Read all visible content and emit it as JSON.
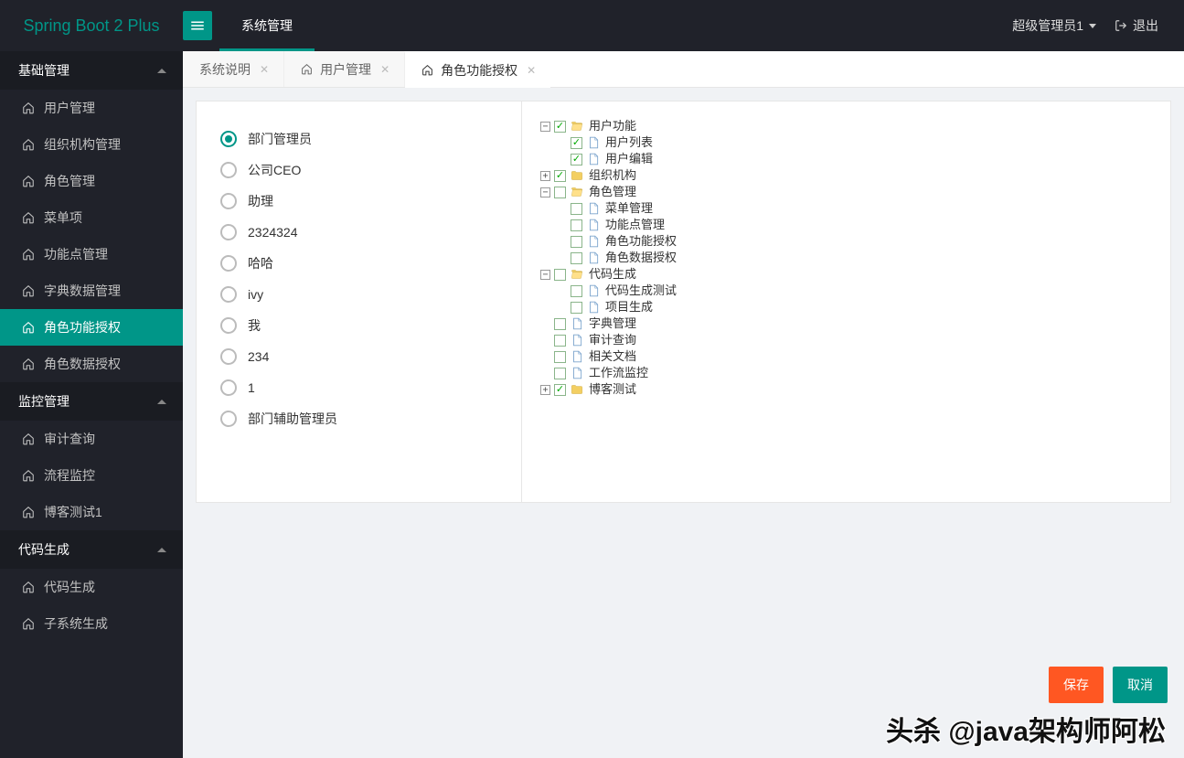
{
  "header": {
    "logo": "Spring Boot 2 Plus",
    "top_tabs": [
      {
        "label": "系统管理",
        "active": true
      }
    ],
    "user": "超级管理员1",
    "logout": "退出"
  },
  "sidebar": [
    {
      "title": "基础管理",
      "items": [
        {
          "label": "用户管理",
          "active": false
        },
        {
          "label": "组织机构管理",
          "active": false
        },
        {
          "label": "角色管理",
          "active": false
        },
        {
          "label": "菜单项",
          "active": false
        },
        {
          "label": "功能点管理",
          "active": false
        },
        {
          "label": "字典数据管理",
          "active": false
        },
        {
          "label": "角色功能授权",
          "active": true
        },
        {
          "label": "角色数据授权",
          "active": false
        }
      ]
    },
    {
      "title": "监控管理",
      "items": [
        {
          "label": "审计查询",
          "active": false
        },
        {
          "label": "流程监控",
          "active": false
        },
        {
          "label": "博客测试1",
          "active": false
        }
      ]
    },
    {
      "title": "代码生成",
      "items": [
        {
          "label": "代码生成",
          "active": false
        },
        {
          "label": "子系统生成",
          "active": false
        }
      ]
    }
  ],
  "tabs": [
    {
      "label": "系统说明",
      "icon": false,
      "active": false
    },
    {
      "label": "用户管理",
      "icon": true,
      "active": false
    },
    {
      "label": "角色功能授权",
      "icon": true,
      "active": true
    }
  ],
  "roles": [
    {
      "label": "部门管理员",
      "checked": true
    },
    {
      "label": "公司CEO",
      "checked": false
    },
    {
      "label": "助理",
      "checked": false
    },
    {
      "label": "2324324",
      "checked": false
    },
    {
      "label": "哈哈",
      "checked": false
    },
    {
      "label": "ivy",
      "checked": false
    },
    {
      "label": "我",
      "checked": false
    },
    {
      "label": "234",
      "checked": false
    },
    {
      "label": "1",
      "checked": false
    },
    {
      "label": "部门辅助管理员",
      "checked": false
    }
  ],
  "tree": [
    {
      "label": "用户功能",
      "type": "folder",
      "checked": true,
      "expanded": true,
      "children": [
        {
          "label": "用户列表",
          "type": "file",
          "checked": true
        },
        {
          "label": "用户编辑",
          "type": "file",
          "checked": true
        }
      ]
    },
    {
      "label": "组织机构",
      "type": "folder",
      "checked": true,
      "expanded": false,
      "has_children": true
    },
    {
      "label": "角色管理",
      "type": "folder",
      "checked": false,
      "expanded": true,
      "children": [
        {
          "label": "菜单管理",
          "type": "file",
          "checked": false
        },
        {
          "label": "功能点管理",
          "type": "file",
          "checked": false
        },
        {
          "label": "角色功能授权",
          "type": "file",
          "checked": false
        },
        {
          "label": "角色数据授权",
          "type": "file",
          "checked": false
        }
      ]
    },
    {
      "label": "代码生成",
      "type": "folder",
      "checked": false,
      "expanded": true,
      "children": [
        {
          "label": "代码生成测试",
          "type": "file",
          "checked": false
        },
        {
          "label": "项目生成",
          "type": "file",
          "checked": false
        }
      ]
    },
    {
      "label": "字典管理",
      "type": "file",
      "checked": false
    },
    {
      "label": "审计查询",
      "type": "file",
      "checked": false
    },
    {
      "label": "相关文档",
      "type": "file",
      "checked": false
    },
    {
      "label": "工作流监控",
      "type": "file",
      "checked": false
    },
    {
      "label": "博客测试",
      "type": "folder",
      "checked": true,
      "expanded": false,
      "has_children": true
    }
  ],
  "buttons": {
    "save": "保存",
    "cancel": "取消"
  },
  "watermark": "头杀 @java架构师阿松",
  "colors": {
    "accent": "#009688",
    "orange": "#ff5722",
    "header": "#20222a"
  }
}
